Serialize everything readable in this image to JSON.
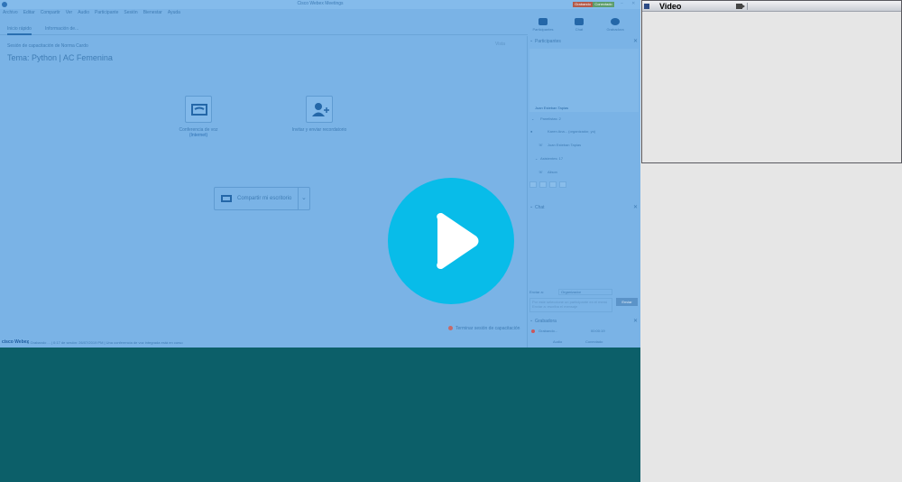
{
  "window": {
    "title": "Cisco Webex Meetings",
    "badge_left": "Grabando",
    "badge_right": "Conectado"
  },
  "menu": [
    "Archivo",
    "Editar",
    "Compartir",
    "Ver",
    "Audio",
    "Participante",
    "Sesión",
    "Bienestar",
    "Ayuda"
  ],
  "tabs": [
    {
      "label": "Inicio rápido",
      "active": true
    },
    {
      "label": "Información de..."
    }
  ],
  "right_icons": [
    {
      "label": "Participantes",
      "icon": "participants-icon"
    },
    {
      "label": "Chat",
      "icon": "chat-icon"
    },
    {
      "label": "Grabadora",
      "icon": "recorder-icon"
    }
  ],
  "session": {
    "subtitle": "Sesión de capacitación de Norma Cardo",
    "topic": "Tema: Python | AC Femenina",
    "view_label": "Vista"
  },
  "actions": {
    "voice_label": "Conferencia de voz",
    "voice_sub": "(Internet)",
    "invite_label": "Invitar y enviar recordatorio",
    "share_label": "Compartir mi escritorio"
  },
  "end_session_label": "Terminar sesión de capacitación",
  "statusbar": {
    "brand": "cisco Webex",
    "text": "● Grabando ...  |  0:17 de sesión: 26/07/2019 PM  |  Una conferencia de voz integrada está en curso"
  },
  "panel": {
    "participants_header": "Participantes",
    "video_name": "Juan Esteban Tapias",
    "panelists_header": "Panelistas: 2",
    "panelists": [
      {
        "name": "Karen Ana... (organizador, yo)"
      },
      {
        "name": "Juan Esteban Tapias"
      }
    ],
    "attendees_header": "Asistentes: 17",
    "attendees": [
      {
        "name": "Alison"
      }
    ],
    "chat_header": "Chat",
    "send_to_label": "Enviar a:",
    "send_to_value": "Organizador",
    "chat_placeholder": "Por este seleccione un participante en el menú Enviar a: escriba el mensaje",
    "send_button": "Enviar",
    "recorder_header": "Grabadora",
    "recorder_status": "Grabando...",
    "recorder_time": "00:00:19",
    "status_audio": "Audio",
    "status_connected": "Conectado"
  },
  "video_window": {
    "title": "Video"
  },
  "colors": {
    "overlay_blue": "#7ab3e6",
    "teal": "#0c5f69",
    "play_button": "#08bce9"
  }
}
